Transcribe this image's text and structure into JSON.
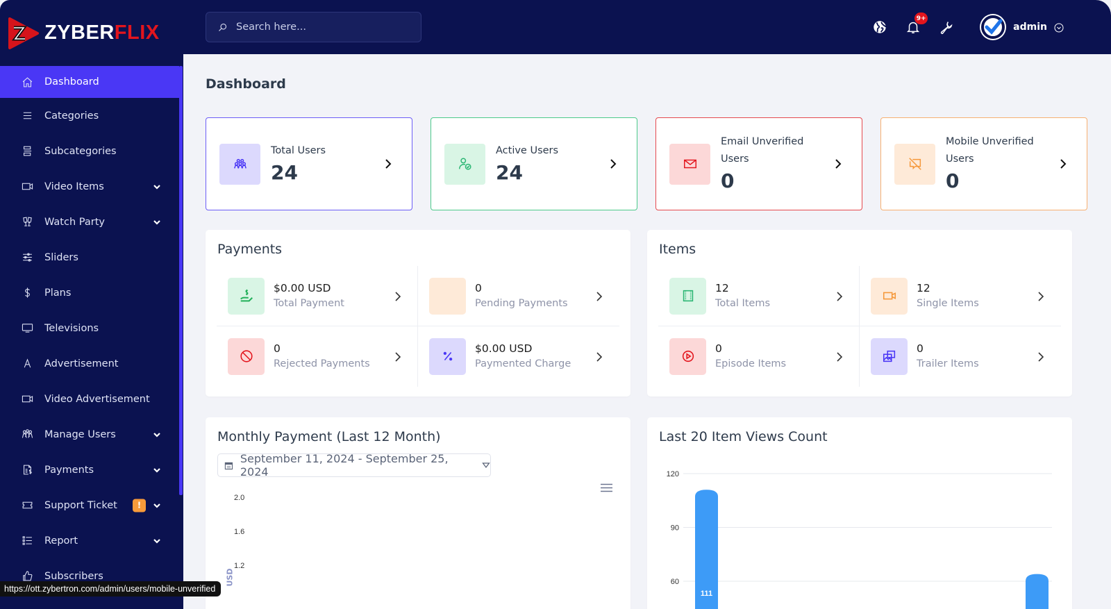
{
  "brand": {
    "name_white": "ZYBER",
    "name_red": "FLIX"
  },
  "search": {
    "placeholder": "Search here..."
  },
  "topbar": {
    "icons": [
      "globe-icon",
      "bell-icon",
      "wrench-icon"
    ],
    "notification_badge": "9+",
    "user_name": "admin"
  },
  "sidebar": {
    "items": [
      {
        "label": "Dashboard",
        "icon": "home-icon",
        "active": true,
        "has_children": false
      },
      {
        "label": "Categories",
        "icon": "list-icon",
        "has_children": false
      },
      {
        "label": "Subcategories",
        "icon": "stack-icon",
        "has_children": false
      },
      {
        "label": "Video Items",
        "icon": "video-icon",
        "has_children": true
      },
      {
        "label": "Watch Party",
        "icon": "glasses-cheers-icon",
        "has_children": true
      },
      {
        "label": "Sliders",
        "icon": "sliders-icon",
        "has_children": false
      },
      {
        "label": "Plans",
        "icon": "dollar-icon",
        "has_children": false
      },
      {
        "label": "Televisions",
        "icon": "tv-icon",
        "has_children": false
      },
      {
        "label": "Advertisement",
        "icon": "letter-a-icon",
        "has_children": false
      },
      {
        "label": "Video Advertisement",
        "icon": "video-icon",
        "has_children": false
      },
      {
        "label": "Manage Users",
        "icon": "users-icon",
        "has_children": true
      },
      {
        "label": "Payments",
        "icon": "invoice-dollar-icon",
        "has_children": true
      },
      {
        "label": "Support Ticket",
        "icon": "ticket-icon",
        "has_children": true,
        "badge": "!"
      },
      {
        "label": "Report",
        "icon": "list-check-icon",
        "has_children": true
      },
      {
        "label": "Subscribers",
        "icon": "thumbs-up-icon",
        "has_children": false
      }
    ]
  },
  "page": {
    "title": "Dashboard"
  },
  "stat_cards": [
    {
      "label": "Total Users",
      "value": "24",
      "color": "#4a37f5",
      "bg": "#dcd9fd",
      "icon": "users-group-icon"
    },
    {
      "label": "Active Users",
      "value": "24",
      "color": "#2bb673",
      "bg": "#d9f5e5",
      "icon": "user-check-icon"
    },
    {
      "label": "Email Unverified Users",
      "value": "0",
      "color": "#e3151d",
      "bg": "#fcd8d8",
      "icon": "mail-icon"
    },
    {
      "label": "Mobile Unverified Users",
      "value": "0",
      "color": "#f5983a",
      "bg": "#feead8",
      "icon": "message-off-icon"
    }
  ],
  "payments": {
    "title": "Payments",
    "cells": [
      {
        "value": "$0.00 USD",
        "label": "Total Payment",
        "color": "#22b05a",
        "bg": "#d9f5e5",
        "icon": "hand-dollar-icon"
      },
      {
        "value": "0",
        "label": "Pending Payments",
        "color": "#f5983a",
        "bg": "#feead8",
        "icon": "loader-icon"
      },
      {
        "value": "0",
        "label": "Rejected Payments",
        "color": "#e3151d",
        "bg": "#fcd8d8",
        "icon": "ban-icon"
      },
      {
        "value": "$0.00 USD",
        "label": "Paymented Charge",
        "color": "#4a37f5",
        "bg": "#dcd9fd",
        "icon": "percent-icon"
      }
    ]
  },
  "items": {
    "title": "Items",
    "cells": [
      {
        "value": "12",
        "label": "Total Items",
        "color": "#2bb673",
        "bg": "#d9f5e5",
        "icon": "film-icon"
      },
      {
        "value": "12",
        "label": "Single Items",
        "color": "#f5983a",
        "bg": "#feead8",
        "icon": "video-icon"
      },
      {
        "value": "0",
        "label": "Episode Items",
        "color": "#e3151d",
        "bg": "#fcd8d8",
        "icon": "play-circle-icon"
      },
      {
        "value": "0",
        "label": "Trailer Items",
        "color": "#4a37f5",
        "bg": "#dcd9fd",
        "icon": "photos-icon"
      }
    ]
  },
  "status_url": "https://ott.zybertron.com/admin/users/mobile-unverified",
  "chart_data": [
    {
      "type": "line",
      "title": "Monthly Payment (Last 12 Month)",
      "date_range": "September 11, 2024 - September 25, 2024",
      "ylabel": "USD",
      "yticks": [
        "2.0",
        "1.6",
        "1.2"
      ],
      "ylim": [
        0,
        2.0
      ],
      "series": [],
      "menu_icon": "hamburger-icon"
    },
    {
      "type": "bar",
      "title": "Last 20 Item Views Count",
      "yticks": [
        120,
        90,
        60
      ],
      "ylim": [
        0,
        120
      ],
      "grid": true,
      "visible_values": [
        111,
        64
      ],
      "data_labels": [
        "111",
        ""
      ]
    }
  ]
}
